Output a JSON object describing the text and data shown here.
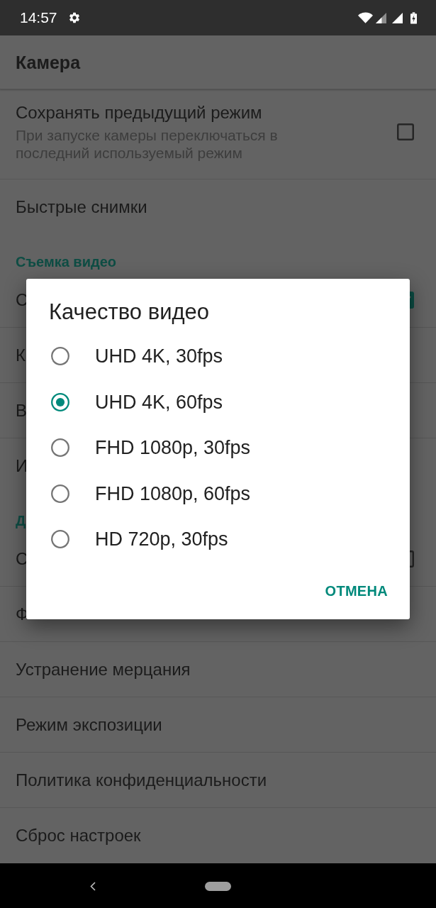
{
  "status_bar": {
    "time": "14:57"
  },
  "toolbar": {
    "title": "Камера"
  },
  "preferences": [
    {
      "kind": "item",
      "title": "Сохранять предыдущий режим",
      "summary": "При запуске камеры переключаться в последний используемый режим",
      "checked": false
    },
    {
      "kind": "item",
      "title": "Быстрые снимки"
    },
    {
      "kind": "header",
      "title": "Съемка видео"
    },
    {
      "kind": "item",
      "title": "С",
      "checked": true
    },
    {
      "kind": "item",
      "title": "К"
    },
    {
      "kind": "item",
      "title": "В"
    },
    {
      "kind": "item",
      "title": "И"
    },
    {
      "kind": "header",
      "title": "Д"
    },
    {
      "kind": "item",
      "title": "С",
      "checked": false
    },
    {
      "kind": "item",
      "title": "Ф"
    },
    {
      "kind": "item",
      "title": "Устранение мерцания"
    },
    {
      "kind": "item",
      "title": "Режим экспозиции"
    },
    {
      "kind": "item",
      "title": "Политика конфиденциальности"
    },
    {
      "kind": "item",
      "title": "Сброс настроек"
    }
  ],
  "dialog": {
    "title": "Качество видео",
    "options": [
      {
        "label": "UHD 4K, 30fps",
        "selected": false
      },
      {
        "label": "UHD 4K, 60fps",
        "selected": true
      },
      {
        "label": "FHD 1080p, 30fps",
        "selected": false
      },
      {
        "label": "FHD 1080p, 60fps",
        "selected": false
      },
      {
        "label": "HD 720p, 30fps",
        "selected": false
      }
    ],
    "buttons": [
      "ОТМЕНА"
    ]
  }
}
